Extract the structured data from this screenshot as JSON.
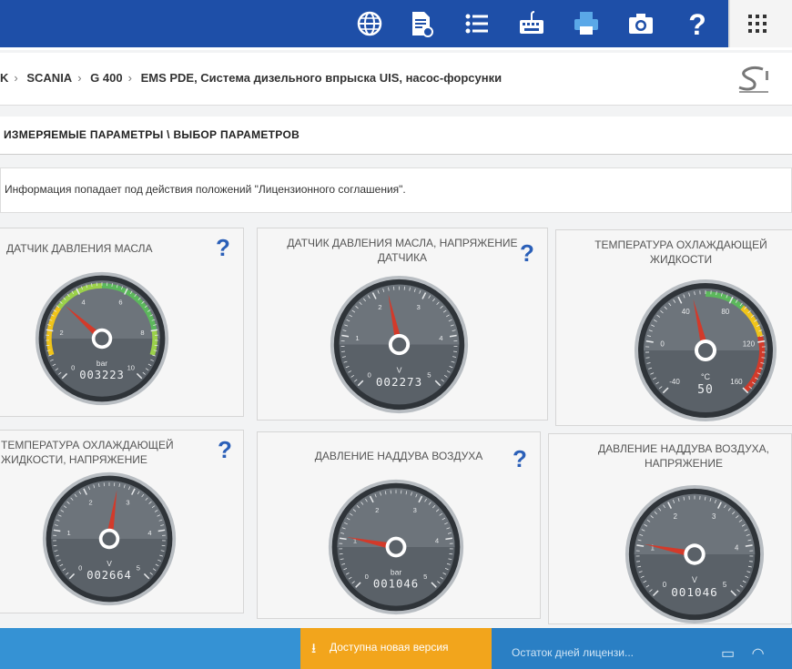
{
  "toolbar": {
    "icons": [
      "globe-icon",
      "document-icon",
      "list-icon",
      "keyboard-icon",
      "printer-icon",
      "camera-icon",
      "help-icon",
      "apps-grid-icon"
    ]
  },
  "breadcrumb": {
    "items": [
      "K",
      "SCANIA",
      "G 400",
      "EMS PDE, Система дизельного впрыска UIS, насос-форсунки"
    ]
  },
  "section": {
    "title": "ИЗМЕРЯЕМЫЕ ПАРАМЕТРЫ \\ ВЫБОР ПАРАМЕТРОВ"
  },
  "notice": {
    "text": "Информация попадает под действия положений \"Лицензионного соглашения\"."
  },
  "gauges": [
    {
      "title": "ДАТЧИК ДАВЛЕНИЯ МАСЛА",
      "ticks": [
        "0",
        "2",
        "4",
        "6",
        "8",
        "10"
      ],
      "min": 0,
      "max": 10,
      "value": 3.223,
      "unit": "bar",
      "display": "003223",
      "has_help": true,
      "help": "?",
      "colored_arc": "oil"
    },
    {
      "title": "ДАТЧИК ДАВЛЕНИЯ МАСЛА, НАПРЯЖЕНИЕ ДАТЧИКА",
      "ticks": [
        "0",
        "1",
        "2",
        "3",
        "4",
        "5"
      ],
      "min": 0,
      "max": 5,
      "value": 2.273,
      "unit": "V",
      "display": "002273",
      "has_help": true,
      "help": "?",
      "colored_arc": "none"
    },
    {
      "title": "ТЕМПЕРАТУРА ОХЛАЖДАЮЩЕЙ ЖИДКОСТИ",
      "ticks": [
        "-40",
        "0",
        "40",
        "80",
        "120",
        "160"
      ],
      "min": -40,
      "max": 160,
      "value": 50,
      "unit": "°C",
      "display": "50",
      "has_help": false,
      "help": "",
      "colored_arc": "temp"
    },
    {
      "title": "ТЕМПЕРАТУРА ОХЛАЖДАЮЩЕЙ ЖИДКОСТИ, НАПРЯЖЕНИЕ",
      "ticks": [
        "0",
        "1",
        "2",
        "3",
        "4",
        "5"
      ],
      "min": 0,
      "max": 5,
      "value": 2.664,
      "unit": "V",
      "display": "002664",
      "has_help": true,
      "help": "?",
      "colored_arc": "none"
    },
    {
      "title": "ДАВЛЕНИЕ НАДДУВА ВОЗДУХА",
      "ticks": [
        "0",
        "1",
        "2",
        "3",
        "4",
        "5"
      ],
      "min": 0,
      "max": 5,
      "value": 1.046,
      "unit": "bar",
      "display": "001046",
      "has_help": true,
      "help": "?",
      "colored_arc": "none"
    },
    {
      "title": "ДАВЛЕНИЕ НАДДУВА ВОЗДУХА, НАПРЯЖЕНИЕ",
      "ticks": [
        "0",
        "1",
        "2",
        "3",
        "4",
        "5"
      ],
      "min": 0,
      "max": 5,
      "value": 1.046,
      "unit": "V",
      "display": "001046",
      "has_help": false,
      "help": "",
      "colored_arc": "none"
    }
  ],
  "bottombar": {
    "update_text": "Доступна новая версия",
    "license_text": "Остаток дней лицензи..."
  },
  "colors": {
    "toolbar_blue": "#1e4fa8",
    "help_blue": "#2a5fb8",
    "needle_red": "#d33a2a",
    "update_orange": "#f2a51c"
  }
}
